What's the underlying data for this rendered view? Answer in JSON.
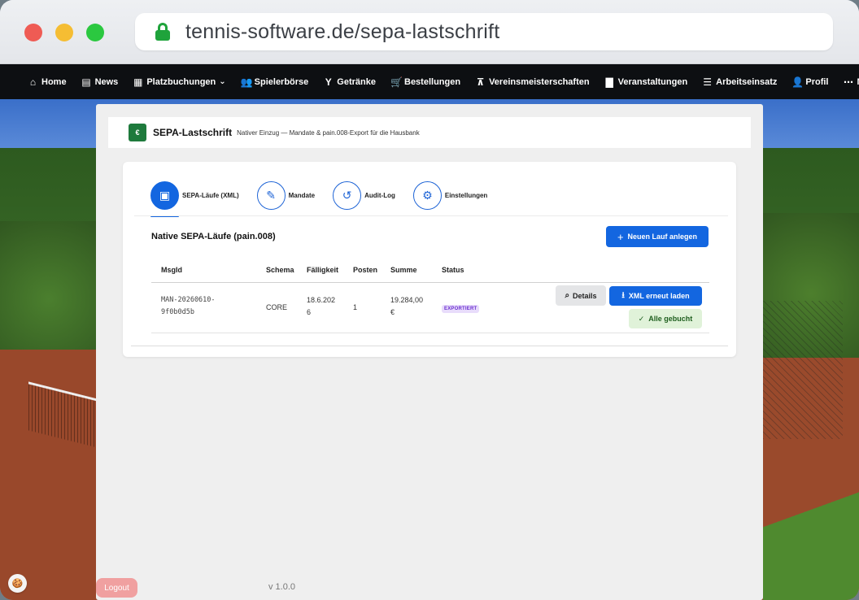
{
  "browser": {
    "url": "tennis-software.de/sepa-lastschrift"
  },
  "nav": {
    "items": [
      {
        "label": "Home",
        "icon": "home-icon",
        "glyph": "⌂"
      },
      {
        "label": "News",
        "icon": "newspaper-icon",
        "glyph": "▤"
      },
      {
        "label": "Platzbuchungen",
        "icon": "calendar-grid-icon",
        "glyph": "▦",
        "dropdown": true
      },
      {
        "label": "Spielerbörse",
        "icon": "users-icon",
        "glyph": "👥"
      },
      {
        "label": "Getränke",
        "icon": "cocktail-icon",
        "glyph": "Y"
      },
      {
        "label": "Bestellungen",
        "icon": "cart-icon",
        "glyph": "🛒"
      },
      {
        "label": "Vereinsmeisterschaften",
        "icon": "sitemap-icon",
        "glyph": "⊼"
      },
      {
        "label": "Veranstaltungen",
        "icon": "calendar-icon",
        "glyph": "▇"
      },
      {
        "label": "Arbeitseinsatz",
        "icon": "checklist-icon",
        "glyph": "☰"
      },
      {
        "label": "Profil",
        "icon": "user-gear-icon",
        "glyph": "👤"
      },
      {
        "label": "Mehr",
        "icon": "ellipsis-icon",
        "glyph": "⋯",
        "dropdown": true
      }
    ]
  },
  "page": {
    "icon_text": "€",
    "title": "SEPA-Lastschrift",
    "subtitle": "Nativer Einzug — Mandate & pain.008-Export für die Hausbank"
  },
  "tabs": [
    {
      "label": "SEPA-Läufe (XML)",
      "icon": "money-bill-icon",
      "glyph": "▣",
      "active": true
    },
    {
      "label": "Mandate",
      "icon": "pen-icon",
      "glyph": "✎",
      "active": false
    },
    {
      "label": "Audit-Log",
      "icon": "history-icon",
      "glyph": "↺",
      "active": false
    },
    {
      "label": "Einstellungen",
      "icon": "gear-icon",
      "glyph": "⚙",
      "active": false
    }
  ],
  "section": {
    "title": "Native SEPA-Läufe (pain.008)",
    "new_button": "Neuen Lauf anlegen"
  },
  "table": {
    "columns": [
      "MsgId",
      "Schema",
      "Fälligkeit",
      "Posten",
      "Summe",
      "Status"
    ],
    "rows": [
      {
        "msgid_line1": "MAN-20260610-",
        "msgid_line2": "9f0b0d5b",
        "schema": "CORE",
        "faelligkeit_line1": "18.6.202",
        "faelligkeit_line2": "6",
        "posten": "1",
        "summe_line1": "19.284,00",
        "summe_line2": "€",
        "status": "EXPORTIERT",
        "actions": {
          "details": "Details",
          "xml": "XML erneut laden",
          "gebucht": "Alle gebucht"
        }
      }
    ]
  },
  "footer": {
    "logout": "Logout",
    "version": "v 1.0.0"
  },
  "colors": {
    "primary": "#1366e0",
    "brand_green": "#1e7a3c",
    "status_badge_bg": "#e8dcfb",
    "status_badge_text": "#6b2fd0",
    "success_bg": "#e0f2d9",
    "logout_bg": "#f0a0a0"
  }
}
